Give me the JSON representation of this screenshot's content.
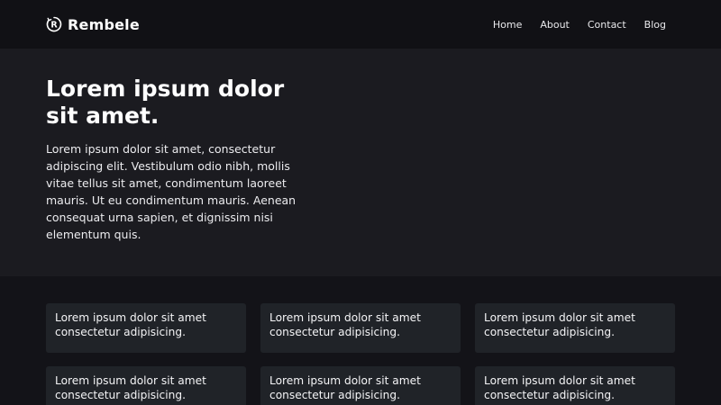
{
  "brand": {
    "logo_letter": "R",
    "name": "Rembele"
  },
  "nav": {
    "items": [
      {
        "label": "Home"
      },
      {
        "label": "About"
      },
      {
        "label": "Contact"
      },
      {
        "label": "Blog"
      }
    ]
  },
  "hero": {
    "title": "Lorem ipsum dolor sit amet.",
    "text": "Lorem ipsum dolor sit amet, consectetur adipiscing elit. Vestibulum odio nibh, mollis vitae tellus sit amet, condimentum laoreet mauris. Ut eu condimentum mauris. Aenean consequat urna sapien, et dignissim nisi elementum quis."
  },
  "cards": [
    {
      "text": "Lorem ipsum dolor sit amet consectetur adipisicing."
    },
    {
      "text": "Lorem ipsum dolor sit amet consectetur adipisicing."
    },
    {
      "text": "Lorem ipsum dolor sit amet consectetur adipisicing."
    },
    {
      "text": "Lorem ipsum dolor sit amet consectetur adipisicing."
    },
    {
      "text": "Lorem ipsum dolor sit amet consectetur adipisicing."
    },
    {
      "text": "Lorem ipsum dolor sit amet consectetur adipisicing."
    }
  ],
  "colors": {
    "navbar_bg": "#111115",
    "hero_bg": "#1b1b20",
    "page_bg": "#131318",
    "card_bg": "#202328",
    "text": "#ffffff"
  },
  "icons": {
    "brand_logo": "registered-r-circle-icon"
  }
}
